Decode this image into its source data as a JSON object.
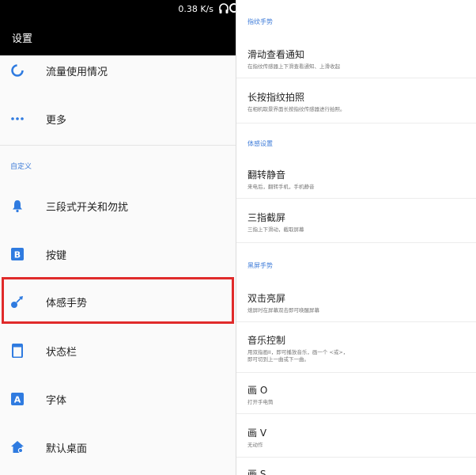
{
  "status_bar": {
    "network_speed": "0.38 K/s"
  },
  "header": {
    "title": "设置"
  },
  "left_menu": {
    "items": [
      {
        "label": "流量使用情况",
        "icon": "data-usage-icon"
      },
      {
        "label": "更多",
        "icon": "more-dots-icon"
      }
    ],
    "section_label": "自定义",
    "custom_items": [
      {
        "label": "三段式开关和勿扰",
        "icon": "bell-icon"
      },
      {
        "label": "按键",
        "icon": "b-key-icon"
      },
      {
        "label": "体感手势",
        "icon": "gesture-icon"
      },
      {
        "label": "状态栏",
        "icon": "phone-statusbar-icon"
      },
      {
        "label": "字体",
        "icon": "font-a-icon"
      },
      {
        "label": "默认桌面",
        "icon": "home-gear-icon"
      }
    ],
    "highlighted_item": "体感手势"
  },
  "right_panel": {
    "sections": [
      {
        "header": "指纹手势",
        "items": [
          {
            "title": "滑动查看通知",
            "description": "在指纹传感器上下滑查看通知、上滑收起"
          },
          {
            "title": "长按指纹拍照",
            "description": "在相机取景界面长按指纹传感器进行拍照。"
          }
        ]
      },
      {
        "header": "体感设置",
        "items": [
          {
            "title": "翻转静音",
            "description": "来电后，翻转手机，手机静音"
          },
          {
            "title": "三指截屏",
            "description": "三指上下滑动，截取屏幕"
          }
        ]
      },
      {
        "header": "黑屏手势",
        "items": [
          {
            "title": "双击亮屏",
            "description": "熄屏时在屏幕双击即可唤醒屏幕"
          },
          {
            "title": "音乐控制",
            "description": "用双指画II，即可播放音乐，画一个 <或>，即可切到上一曲或下一曲。"
          },
          {
            "title": "画 O",
            "description": "打开手电筒"
          },
          {
            "title": "画 V",
            "description": "无动作"
          },
          {
            "title": "画 S",
            "description": ""
          }
        ]
      }
    ]
  },
  "colors": {
    "accent": "#3d7bd8",
    "highlight_border": "#e02a2a",
    "app_bar": "#000000"
  }
}
